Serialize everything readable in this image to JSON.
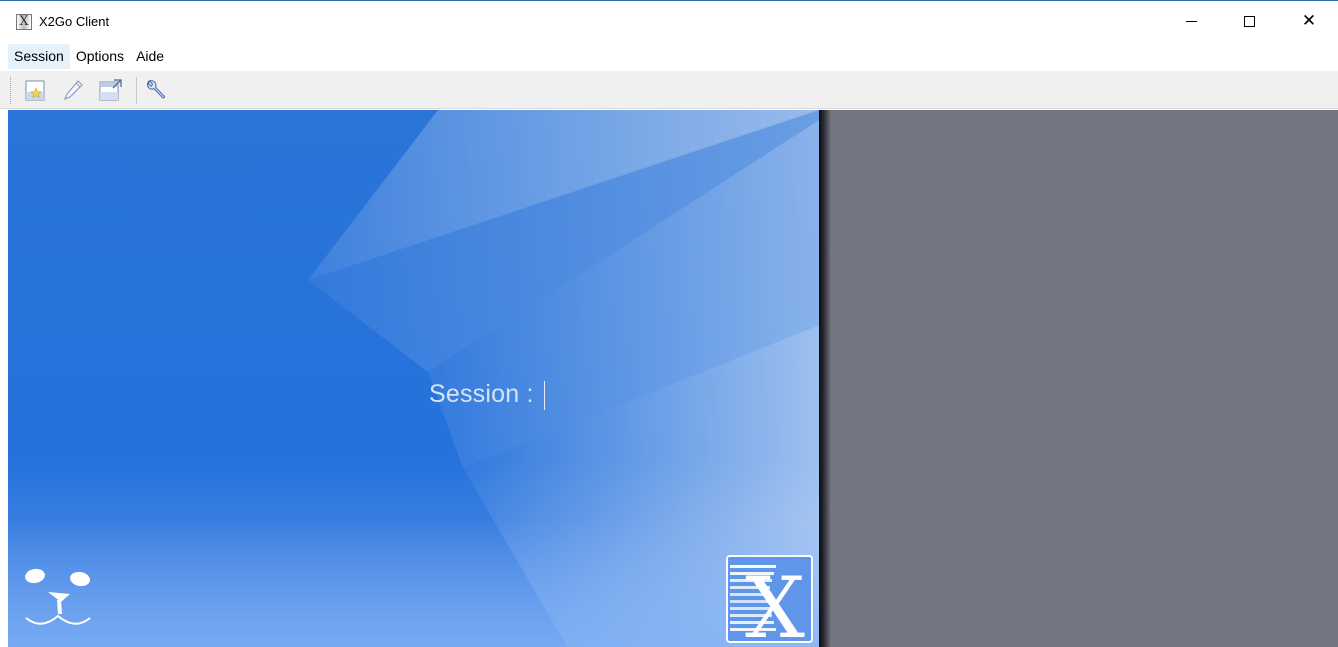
{
  "window": {
    "title": "X2Go Client",
    "controls": {
      "minimize": "minimize",
      "maximize": "maximize",
      "close": "close"
    }
  },
  "menubar": {
    "items": [
      "Session",
      "Options",
      "Aide"
    ],
    "active_index": 0
  },
  "toolbar": {
    "buttons": [
      {
        "name": "new-session",
        "icon": "new-session-icon"
      },
      {
        "name": "edit-session",
        "icon": "pencil-icon"
      },
      {
        "name": "session-export",
        "icon": "export-icon"
      },
      {
        "name": "settings",
        "icon": "wrench-icon"
      }
    ]
  },
  "main": {
    "session_label": "Session :",
    "session_input_value": ""
  },
  "colors": {
    "banner_blue": "#2572dc",
    "right_panel": "#757683",
    "menu_highlight": "#e5f1fb",
    "toolbar_bg": "#f0f0f0"
  }
}
